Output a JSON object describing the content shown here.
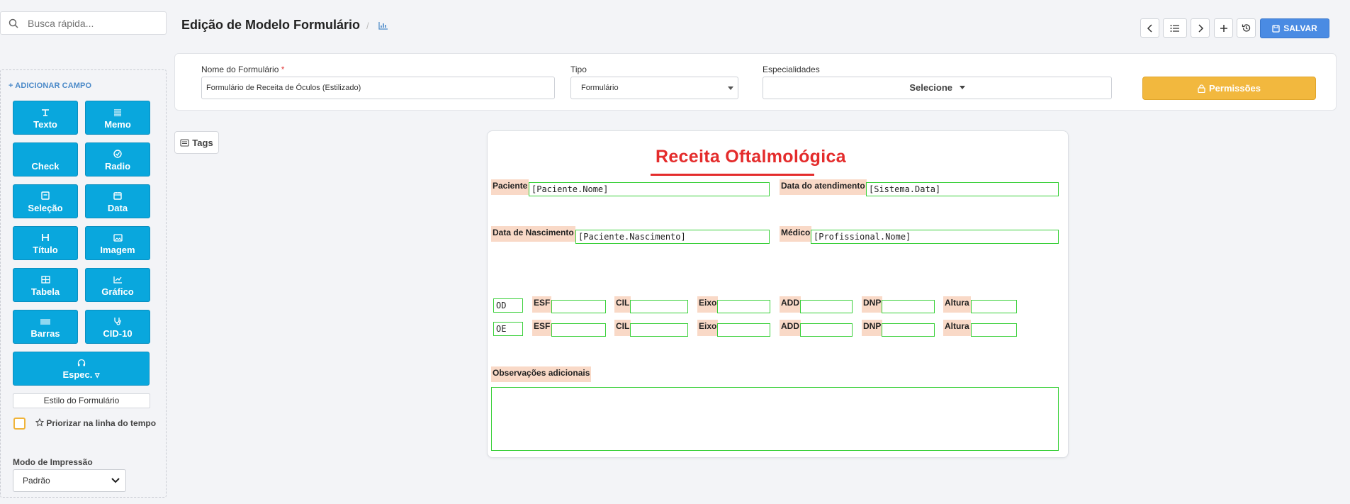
{
  "search": {
    "placeholder": "Busca rápida..."
  },
  "sidebar": {
    "add_label": "+ ADICIONAR CAMPO",
    "buttons": [
      {
        "label": "Texto",
        "icon": "text-icon"
      },
      {
        "label": "Memo",
        "icon": "lines-icon"
      },
      {
        "label": "Check",
        "icon": "check-icon"
      },
      {
        "label": "Radio",
        "icon": "radio-icon"
      },
      {
        "label": "Seleção",
        "icon": "select-icon"
      },
      {
        "label": "Data",
        "icon": "calendar-icon"
      },
      {
        "label": "Título",
        "icon": "heading-icon"
      },
      {
        "label": "Imagem",
        "icon": "image-icon"
      },
      {
        "label": "Tabela",
        "icon": "table-icon"
      },
      {
        "label": "Gráfico",
        "icon": "chart-icon"
      },
      {
        "label": "Barras",
        "icon": "barcode-icon"
      },
      {
        "label": "CID-10",
        "icon": "stethoscope-icon"
      },
      {
        "label": "Espec. ▿",
        "icon": "headphones-icon"
      }
    ],
    "style_button": "Estilo do Formulário",
    "priority_label": "Priorizar na linha do tempo",
    "print_mode_label": "Modo de Impressão",
    "print_mode_value": "Padrão"
  },
  "header": {
    "title": "Edição de Modelo Formulário",
    "separator": "/",
    "save_label": "SALVAR"
  },
  "form": {
    "name_label": "Nome do Formulário",
    "required_mark": "*",
    "name_value": "Formulário de Receita de Óculos (Estilizado)",
    "type_label": "Tipo",
    "type_value": "Formulário",
    "specialties_label": "Especialidades",
    "specialties_value": "Selecione",
    "permissions_label": "Permissões"
  },
  "tags_label": "Tags",
  "document": {
    "title": "Receita Oftalmológica",
    "paciente_label": "Paciente",
    "paciente_value": "[Paciente.Nome]",
    "atendimento_label": "Data do atendimento",
    "atendimento_value": "[Sistema.Data]",
    "nascimento_label": "Data de Nascimento",
    "nascimento_value": "[Paciente.Nascimento]",
    "medico_label": "Médico",
    "medico_value": "[Profissional.Nome]",
    "rows": [
      {
        "eye": "OD"
      },
      {
        "eye": "OE"
      }
    ],
    "columns": [
      "ESF",
      "CIL",
      "Eixo",
      "ADD",
      "DNP",
      "Altura"
    ],
    "obs_label": "Observações adicionais"
  },
  "colors": {
    "field_button": "#09a7dd",
    "save": "#4a8be3",
    "permissions": "#f2b83e",
    "title_red": "#e42c2c",
    "field_border": "#39d039",
    "label_bg": "#f9d9c7"
  }
}
